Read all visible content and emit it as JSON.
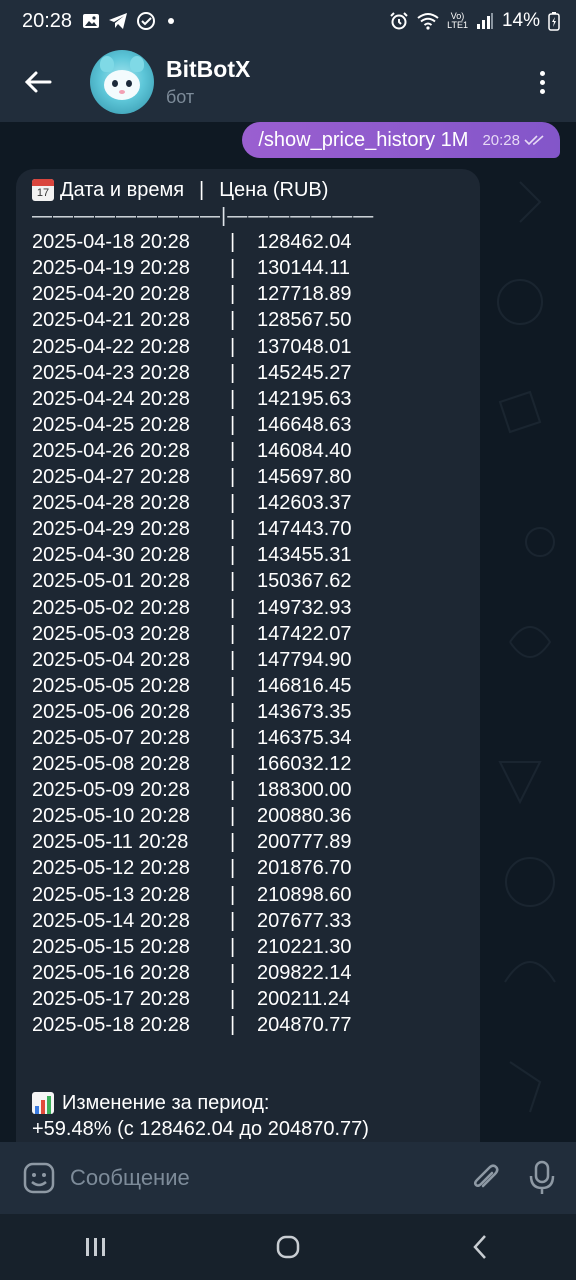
{
  "status_bar": {
    "time": "20:28",
    "volte_label_top": "Vo)",
    "volte_label_bottom": "LTE1",
    "battery": "14%"
  },
  "header": {
    "title": "BitBotX",
    "subtitle": "бот"
  },
  "outgoing_message": {
    "text": "/show_price_history 1M",
    "time": "20:28"
  },
  "incoming_message": {
    "header_date": "Дата и время",
    "header_divider": "|",
    "header_price": "Цена (RUB)",
    "separator": "—————————|———————",
    "column_divider": "|",
    "rows": [
      {
        "date": "2025-04-18 20:28",
        "price": "128462.04"
      },
      {
        "date": "2025-04-19 20:28",
        "price": "130144.11"
      },
      {
        "date": "2025-04-20 20:28",
        "price": "127718.89"
      },
      {
        "date": "2025-04-21 20:28",
        "price": "128567.50"
      },
      {
        "date": "2025-04-22 20:28",
        "price": "137048.01"
      },
      {
        "date": "2025-04-23 20:28",
        "price": "145245.27"
      },
      {
        "date": "2025-04-24 20:28",
        "price": "142195.63"
      },
      {
        "date": "2025-04-25 20:28",
        "price": "146648.63"
      },
      {
        "date": "2025-04-26 20:28",
        "price": "146084.40"
      },
      {
        "date": "2025-04-27 20:28",
        "price": "145697.80"
      },
      {
        "date": "2025-04-28 20:28",
        "price": "142603.37"
      },
      {
        "date": "2025-04-29 20:28",
        "price": "147443.70"
      },
      {
        "date": "2025-04-30 20:28",
        "price": "143455.31"
      },
      {
        "date": "2025-05-01 20:28",
        "price": "150367.62"
      },
      {
        "date": "2025-05-02 20:28",
        "price": "149732.93"
      },
      {
        "date": "2025-05-03 20:28",
        "price": "147422.07"
      },
      {
        "date": "2025-05-04 20:28",
        "price": "147794.90"
      },
      {
        "date": "2025-05-05 20:28",
        "price": "146816.45"
      },
      {
        "date": "2025-05-06 20:28",
        "price": "143673.35"
      },
      {
        "date": "2025-05-07 20:28",
        "price": "146375.34"
      },
      {
        "date": "2025-05-08 20:28",
        "price": "166032.12"
      },
      {
        "date": "2025-05-09 20:28",
        "price": "188300.00"
      },
      {
        "date": "2025-05-10 20:28",
        "price": "200880.36"
      },
      {
        "date": "2025-05-11 20:28",
        "price": "200777.89"
      },
      {
        "date": "2025-05-12 20:28",
        "price": "201876.70"
      },
      {
        "date": "2025-05-13 20:28",
        "price": "210898.60"
      },
      {
        "date": "2025-05-14 20:28",
        "price": "207677.33"
      },
      {
        "date": "2025-05-15 20:28",
        "price": "210221.30"
      },
      {
        "date": "2025-05-16 20:28",
        "price": "209822.14"
      },
      {
        "date": "2025-05-17 20:28",
        "price": "200211.24"
      },
      {
        "date": "2025-05-18 20:28",
        "price": "204870.77"
      }
    ],
    "change_label": "Изменение за период:",
    "change_value": "+59.48% (с 128462.04 до 204870.77)",
    "calendar_icon_number": "17"
  },
  "input": {
    "placeholder": "Сообщение"
  },
  "colors": {
    "outgoing_bubble": "#8c5ac8",
    "incoming_bubble": "#1d2733",
    "header": "#212d3b",
    "chat_background": "#0f1923"
  },
  "icons": [
    "back-arrow-icon",
    "more-vert-icon",
    "calendar-icon",
    "bar-chart-icon",
    "emoji-icon",
    "attach-icon",
    "mic-icon",
    "double-check-icon"
  ]
}
